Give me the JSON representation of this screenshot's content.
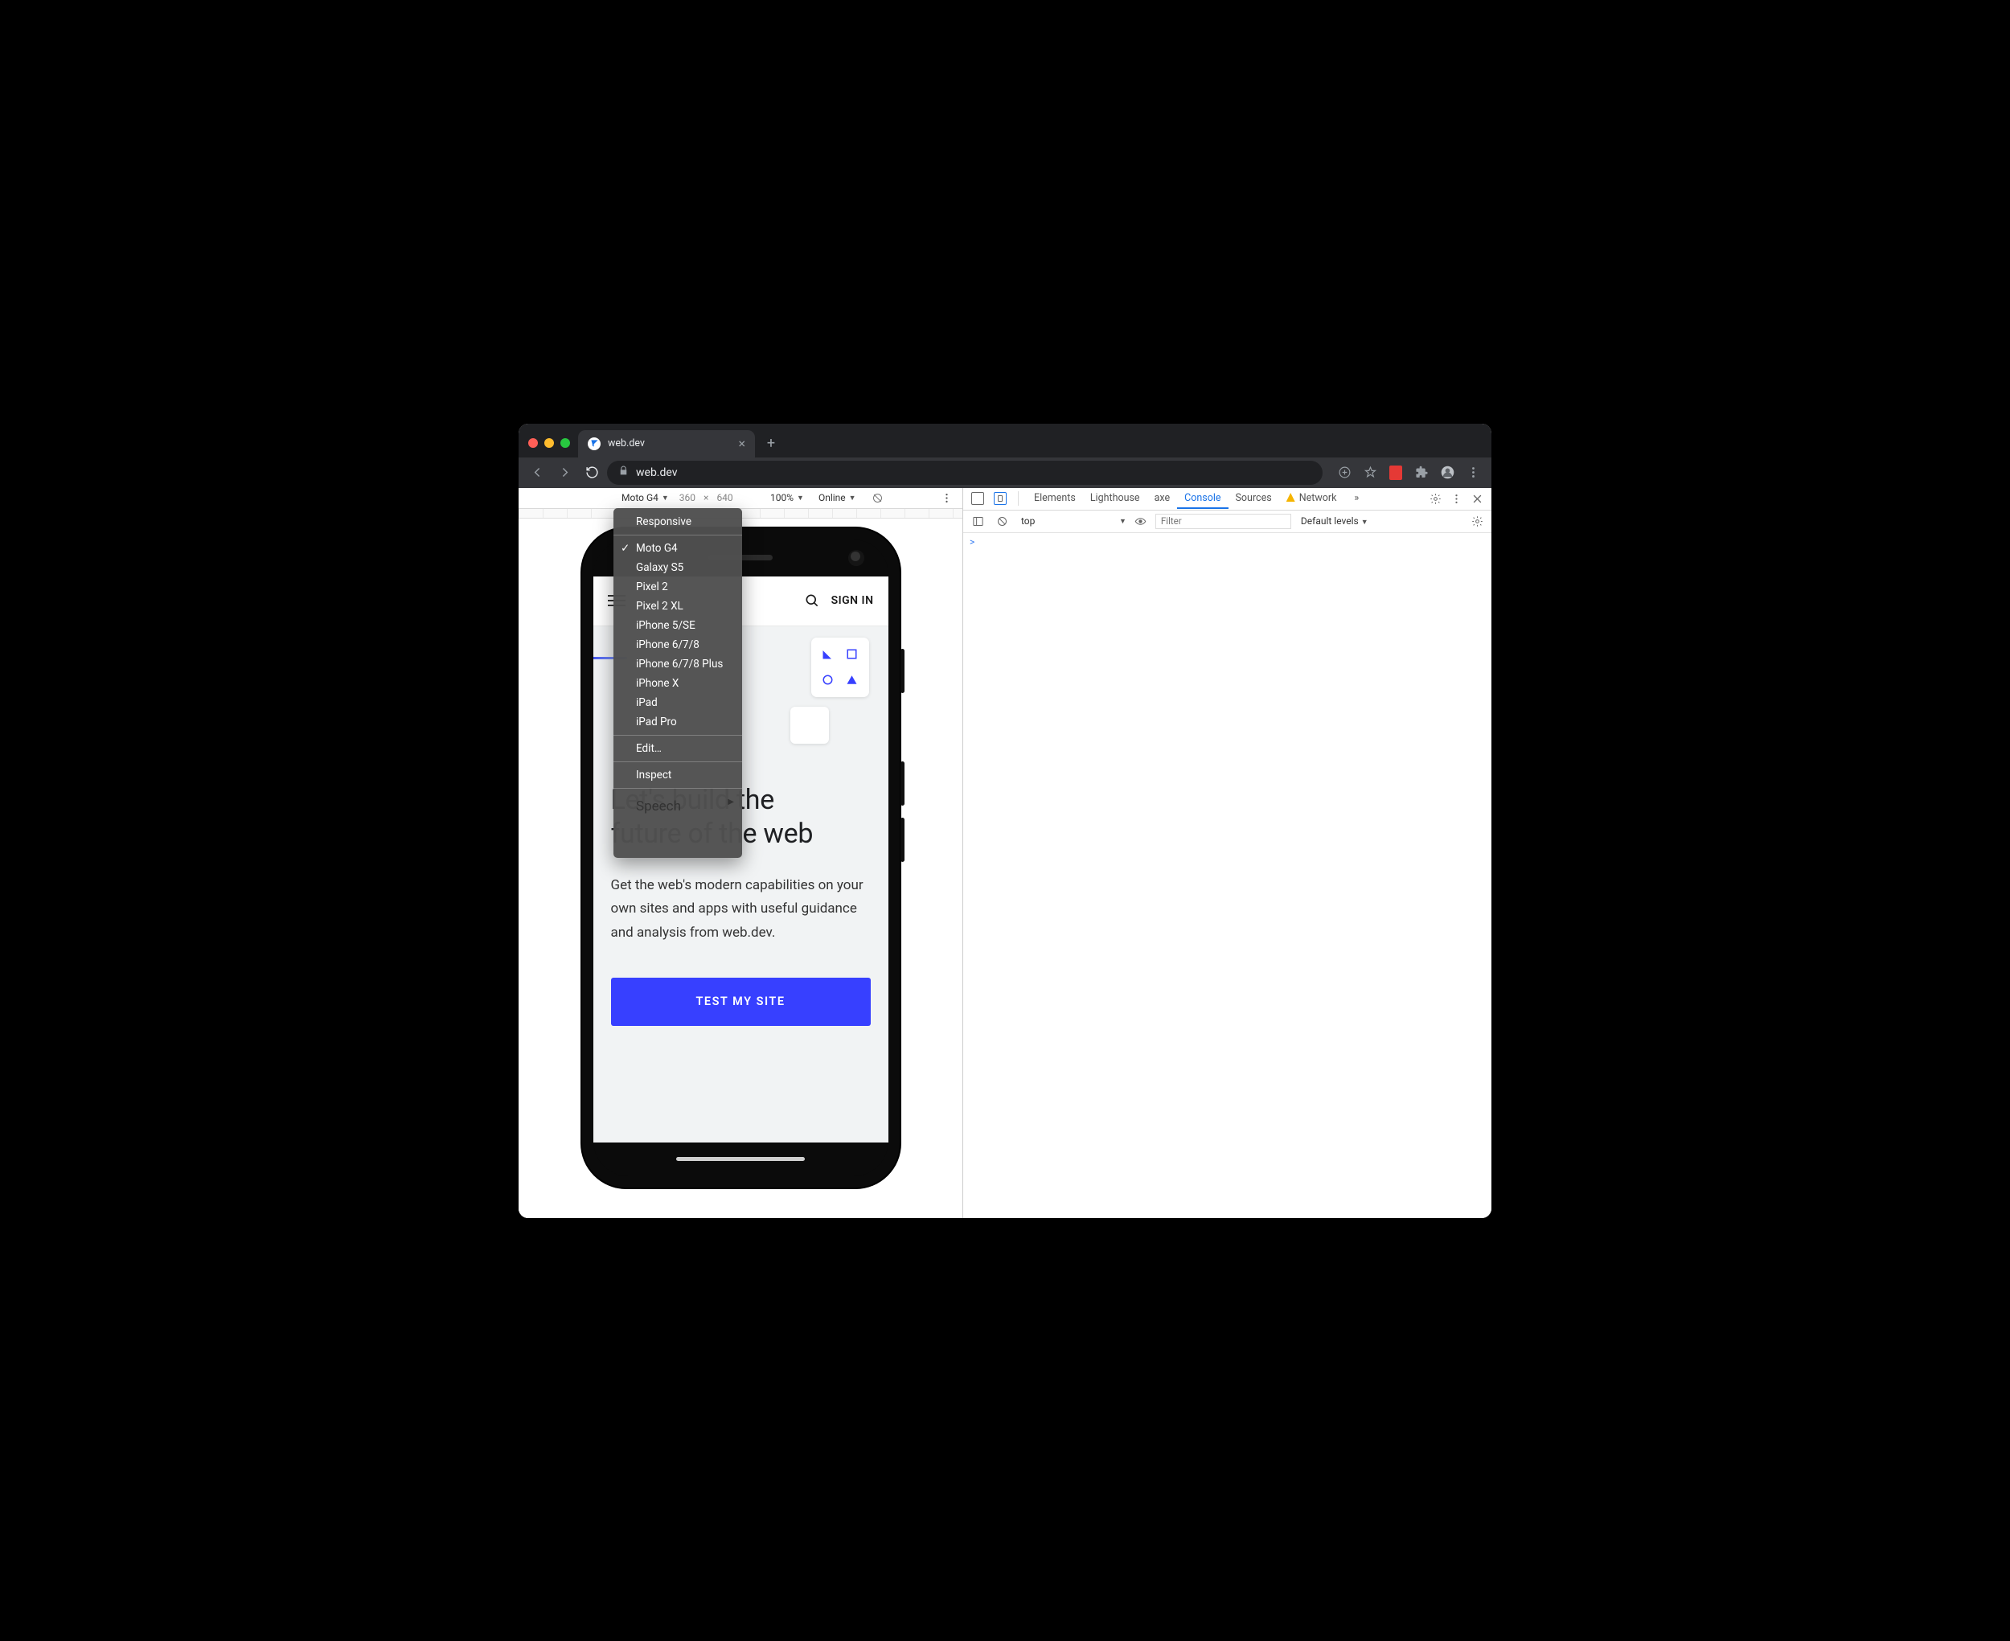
{
  "browser": {
    "tab_title": "web.dev",
    "url": "web.dev",
    "close_glyph": "×",
    "newtab_glyph": "+"
  },
  "device_toolbar": {
    "device_label": "Moto G4",
    "width": "360",
    "height": "640",
    "zoom": "100%",
    "throttle": "Online",
    "x": "×"
  },
  "dropdown": {
    "section1": [
      "Responsive"
    ],
    "devices": [
      "Moto G4",
      "Galaxy S5",
      "Pixel 2",
      "Pixel 2 XL",
      "iPhone 5/SE",
      "iPhone 6/7/8",
      "iPhone 6/7/8 Plus",
      "iPhone X",
      "iPad",
      "iPad Pro"
    ],
    "selected": "Moto G4",
    "edit": "Edit…",
    "inspect": "Inspect",
    "speech": "Speech"
  },
  "page": {
    "sign_in": "SIGN IN",
    "h1_a": "Let's build the",
    "h1_b": "future of the web",
    "sub": "Get the web's modern capabilities on your own sites and apps with useful guidance and analysis from web.dev.",
    "cta": "TEST MY SITE"
  },
  "devtools": {
    "tabs": [
      "Elements",
      "Lighthouse",
      "axe",
      "Console",
      "Sources",
      "Network"
    ],
    "active": "Console",
    "warn_tab": "Network",
    "more": "»",
    "context": "top",
    "filter_placeholder": "Filter",
    "levels": "Default levels",
    "prompt": ">"
  },
  "colors": {
    "accent": "#3740ff",
    "dt_active": "#1a73e8"
  }
}
